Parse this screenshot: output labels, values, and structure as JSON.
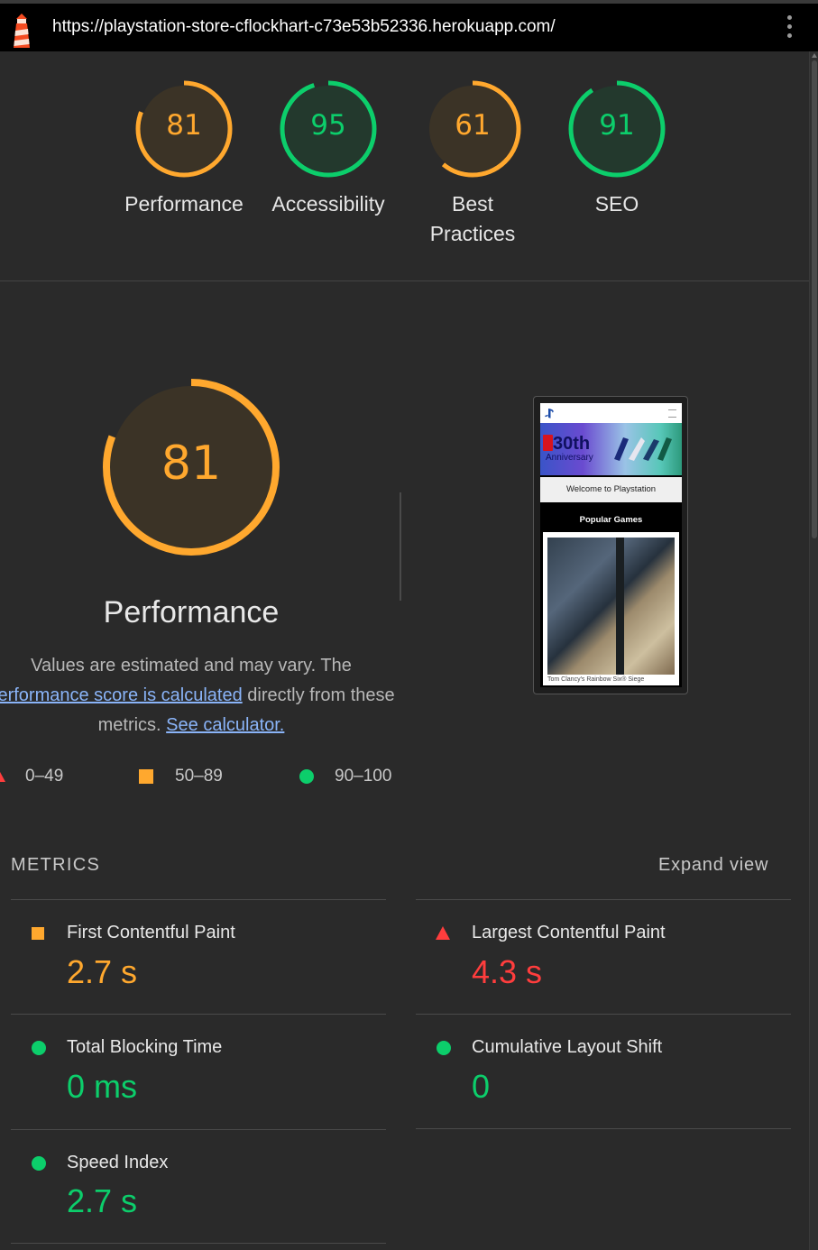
{
  "browser": {
    "url": "https://playstation-store-cflockhart-c73e53b52336.herokuapp.com/"
  },
  "colors": {
    "orange": "#ffa82e",
    "green": "#0cce6b",
    "red": "#ff3d3d",
    "link": "#8ab4f8",
    "background": "#2a2a2a"
  },
  "gauges": [
    {
      "score": "81",
      "label": "Performance",
      "status": "average"
    },
    {
      "score": "95",
      "label": "Accessibility",
      "status": "pass"
    },
    {
      "score": "61",
      "label": "Best Practices",
      "status": "average"
    },
    {
      "score": "91",
      "label": "SEO",
      "status": "pass"
    }
  ],
  "performance": {
    "score": "81",
    "title": "Performance",
    "desc_before": "Values are estimated and may vary. The ",
    "desc_link": "performance score is calculated",
    "desc_middle": " directly from these metrics. ",
    "desc_calc_link": "See calculator.",
    "legend": [
      {
        "range": "0–49",
        "icon": "red-triangle-icon"
      },
      {
        "range": "50–89",
        "icon": "orange-square-icon"
      },
      {
        "range": "90–100",
        "icon": "green-circle-icon"
      }
    ]
  },
  "screenshot": {
    "banner_text": "30th",
    "banner_sub": "Anniversary",
    "welcome": "Welcome to Playstation",
    "popular": "Popular Games",
    "caption": "Tom Clancy's Rainbow Six® Siege"
  },
  "metrics": {
    "heading": "METRICS",
    "expand_label": "Expand view",
    "items": [
      {
        "label": "First Contentful Paint",
        "value": "2.7 s",
        "status": "average"
      },
      {
        "label": "Largest Contentful Paint",
        "value": "4.3 s",
        "status": "fail"
      },
      {
        "label": "Total Blocking Time",
        "value": "0 ms",
        "status": "pass"
      },
      {
        "label": "Cumulative Layout Shift",
        "value": "0",
        "status": "pass"
      },
      {
        "label": "Speed Index",
        "value": "2.7 s",
        "status": "pass"
      }
    ]
  }
}
